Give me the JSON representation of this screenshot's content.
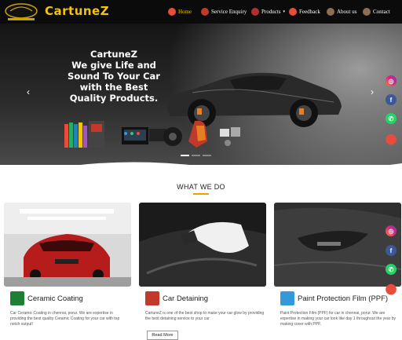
{
  "brand": {
    "name": "CartuneZ",
    "badge_text": "CartuneZ"
  },
  "nav": {
    "items": [
      {
        "label": "Home",
        "icon": "home-icon",
        "active": true
      },
      {
        "label": "Service Enquiry",
        "icon": "car-icon"
      },
      {
        "label": "Products",
        "icon": "products-icon",
        "has_dropdown": true
      },
      {
        "label": "Feedback",
        "icon": "feedback-icon"
      },
      {
        "label": "About us",
        "icon": "about-icon"
      },
      {
        "label": "Contact",
        "icon": "contact-icon"
      }
    ]
  },
  "hero": {
    "line1": "CartuneZ",
    "line2": "We give Life and Sound To Your Car with the Best Quality Products.",
    "slides_count": 3,
    "active_slide": 1
  },
  "section": {
    "title": "WHAT WE DO"
  },
  "cards": [
    {
      "title": "Ceramic Coating",
      "desc": "Car Ceramic Coating in chennai, porur. We are expertise in providing the best quality Ceramic Coating for your car with top notch output!",
      "icon": "ceramic-coating-icon"
    },
    {
      "title": "Car Detaining",
      "desc": "CartuneZ is one of the best shop to make your car glow by providing the best detaining service to your car",
      "button": "Read More",
      "icon": "car-detailing-icon"
    },
    {
      "title": "Paint Protection Film (PPF)",
      "desc": "Paint Protection Film (PPF) for car in chennai, porur. We are expertise in making your car look like day 1 throughout the year by making cover with PPF.",
      "icon": "ppf-icon"
    }
  ],
  "social": [
    "instagram-icon",
    "facebook-icon",
    "whatsapp-icon",
    "location-icon"
  ],
  "colors": {
    "brand_yellow": "#f1c40f",
    "accent_underline": "#e6a400",
    "navbar_bg": "#0b0b0b"
  }
}
